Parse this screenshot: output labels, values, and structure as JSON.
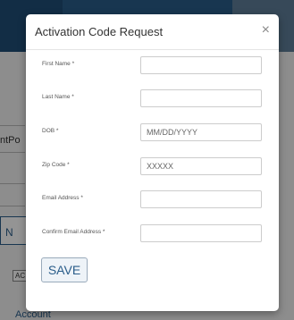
{
  "modal": {
    "title": "Activation Code Request",
    "close_glyph": "×",
    "fields": [
      {
        "label": "First Name *",
        "placeholder": "",
        "value": ""
      },
      {
        "label": "Last Name *",
        "placeholder": "",
        "value": ""
      },
      {
        "label": "DOB *",
        "placeholder": "MM/DD/YYYY",
        "value": ""
      },
      {
        "label": "Zip Code *",
        "placeholder": "XXXXX",
        "value": ""
      },
      {
        "label": "Email Address *",
        "placeholder": "",
        "value": ""
      },
      {
        "label": "Confirm Email Address *",
        "placeholder": "",
        "value": ""
      }
    ],
    "save_label": "SAVE"
  },
  "background": {
    "fragment_1": "ntPo",
    "fragment_2": "N",
    "fragment_3": "AC",
    "fragment_4": "Account"
  },
  "colors": {
    "accent": "#2a5d8a",
    "overlay": "rgba(0,0,0,0.42)"
  }
}
